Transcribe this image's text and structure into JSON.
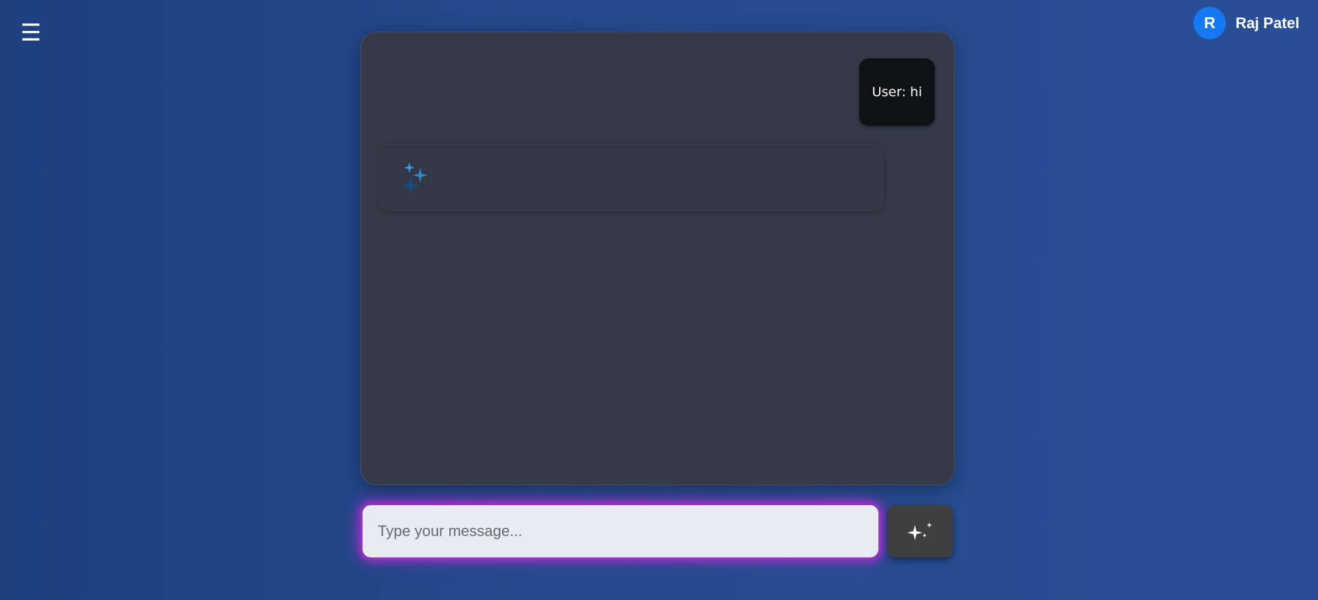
{
  "header": {
    "menu_icon_glyph": "☰",
    "menu_icon": "hamburger-menu-icon"
  },
  "user": {
    "avatar_initial": "R",
    "name": "Raj Patel",
    "avatar_color": "#1479f3"
  },
  "chat": {
    "messages": [
      {
        "role": "user",
        "text": "User: hi"
      },
      {
        "role": "bot",
        "text": "",
        "icon": "sparkle-icon"
      }
    ]
  },
  "composer": {
    "placeholder": "Type your message...",
    "value": "",
    "send_icon": "sparkle-send-icon",
    "glow_color": "#c02fd8"
  },
  "colors": {
    "accent_sparkle_light": "#3aa0e0",
    "accent_sparkle_dark": "#0f4f8a"
  }
}
